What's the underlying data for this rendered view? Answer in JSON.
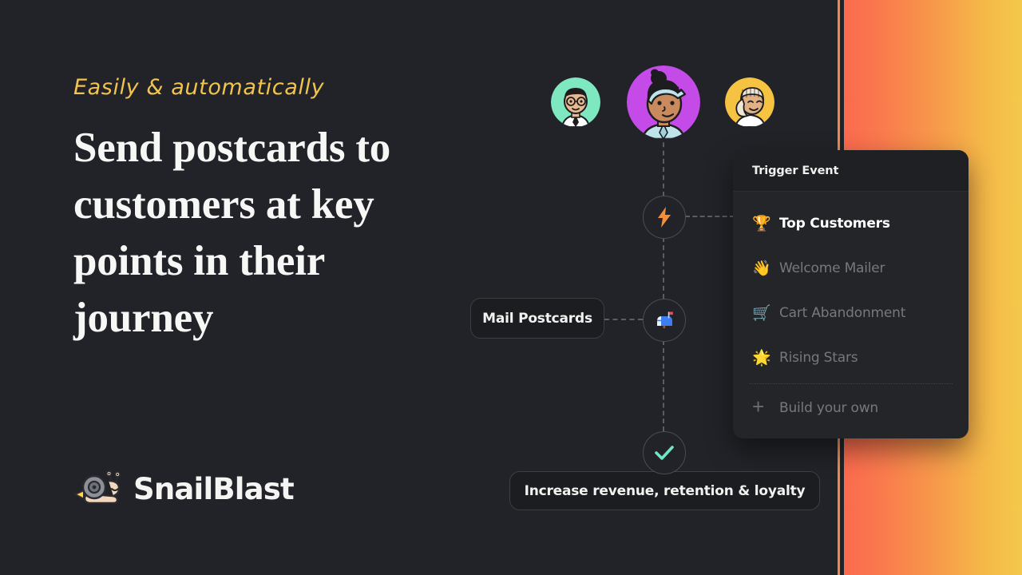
{
  "page": {
    "background_color": "#212328",
    "accent_gradient_from": "#fb6a4f",
    "accent_gradient_to": "#f3c94b",
    "accent_stripe_color": "#f08a4a"
  },
  "hero": {
    "eyebrow": "Easily & automatically",
    "eyebrow_color": "#f3c44c",
    "headline": "Send postcards to customers at key points in their journey",
    "headline_color": "#f7f7f5"
  },
  "logo": {
    "wordmark": "SnailBlast",
    "mark_name": "snail-rocket-icon",
    "shell_color": "#8d9099",
    "flame_color": "#f6a23c",
    "body_color": "#f2d7bd"
  },
  "avatars": [
    {
      "name": "avatar-customer-left",
      "bg": "#7ee8c0",
      "skin": "#e8b98f",
      "hair": "#1d1d1f",
      "accessory": "glasses",
      "size": 62
    },
    {
      "name": "avatar-customer-center",
      "bg": "#c44be8",
      "skin": "#c98a5e",
      "hair": "#1d1d1f",
      "accessory": "headband",
      "size": 92
    },
    {
      "name": "avatar-customer-right",
      "bg": "#f5c242",
      "skin": "#e2b085",
      "hair": "#efe6d4",
      "accessory": "beard",
      "size": 62
    }
  ],
  "flow": {
    "nodes": [
      {
        "name": "trigger-node",
        "icon": "lightning-bolt-icon",
        "glyph": "⚡",
        "label": ""
      },
      {
        "name": "action-node",
        "icon": "mailbox-icon",
        "glyph": "📪",
        "label": "Mail Postcards"
      },
      {
        "name": "outcome-node",
        "icon": "check-icon",
        "glyph": "✓",
        "label": "Increase revenue, retention & loyalty"
      }
    ],
    "pills": {
      "action_label": "Mail Postcards",
      "outcome_label": "Increase revenue, retention & loyalty"
    },
    "check_color": "#6ee7c8",
    "bolt_color": "#f5903a",
    "connector_color": "#5b5d63"
  },
  "dropdown": {
    "header_label": "Trigger Event",
    "items": [
      {
        "name": "dropdown-item-top-customers",
        "icon": "trophy-icon",
        "glyph": "🏆",
        "label": "Top Customers",
        "selected": true
      },
      {
        "name": "dropdown-item-welcome-mailer",
        "icon": "waving-hand-icon",
        "glyph": "👋",
        "label": "Welcome Mailer",
        "selected": false
      },
      {
        "name": "dropdown-item-cart-abandonment",
        "icon": "shopping-cart-icon",
        "glyph": "🛒",
        "label": "Cart Abandonment",
        "selected": false
      },
      {
        "name": "dropdown-item-rising-stars",
        "icon": "glowing-star-icon",
        "glyph": "🌟",
        "label": "Rising Stars",
        "selected": false
      }
    ],
    "build_your_own": {
      "name": "dropdown-item-build-your-own",
      "icon": "plus-icon",
      "glyph": "+",
      "label": "Build your own"
    }
  }
}
